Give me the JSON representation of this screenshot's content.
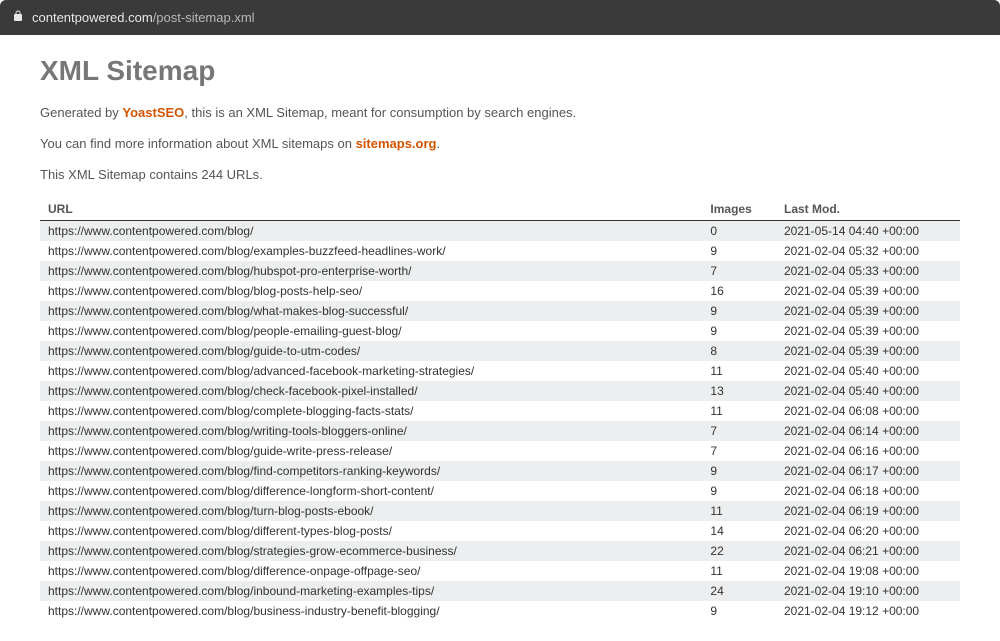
{
  "browser": {
    "domain": "contentpowered.com",
    "path": "/post-sitemap.xml"
  },
  "page": {
    "title": "XML Sitemap",
    "generated_prefix": "Generated by ",
    "generated_linktext": "YoastSEO",
    "generated_suffix": ", this is an XML Sitemap, meant for consumption by search engines.",
    "more_info_prefix": "You can find more information about XML sitemaps on ",
    "more_info_linktext": "sitemaps.org",
    "more_info_suffix": ".",
    "count_text": "This XML Sitemap contains 244 URLs."
  },
  "table": {
    "headers": {
      "url": "URL",
      "images": "Images",
      "lastmod": "Last Mod."
    },
    "rows": [
      {
        "url": "https://www.contentpowered.com/blog/",
        "images": "0",
        "lastmod": "2021-05-14 04:40 +00:00"
      },
      {
        "url": "https://www.contentpowered.com/blog/examples-buzzfeed-headlines-work/",
        "images": "9",
        "lastmod": "2021-02-04 05:32 +00:00"
      },
      {
        "url": "https://www.contentpowered.com/blog/hubspot-pro-enterprise-worth/",
        "images": "7",
        "lastmod": "2021-02-04 05:33 +00:00"
      },
      {
        "url": "https://www.contentpowered.com/blog/blog-posts-help-seo/",
        "images": "16",
        "lastmod": "2021-02-04 05:39 +00:00"
      },
      {
        "url": "https://www.contentpowered.com/blog/what-makes-blog-successful/",
        "images": "9",
        "lastmod": "2021-02-04 05:39 +00:00"
      },
      {
        "url": "https://www.contentpowered.com/blog/people-emailing-guest-blog/",
        "images": "9",
        "lastmod": "2021-02-04 05:39 +00:00"
      },
      {
        "url": "https://www.contentpowered.com/blog/guide-to-utm-codes/",
        "images": "8",
        "lastmod": "2021-02-04 05:39 +00:00"
      },
      {
        "url": "https://www.contentpowered.com/blog/advanced-facebook-marketing-strategies/",
        "images": "11",
        "lastmod": "2021-02-04 05:40 +00:00"
      },
      {
        "url": "https://www.contentpowered.com/blog/check-facebook-pixel-installed/",
        "images": "13",
        "lastmod": "2021-02-04 05:40 +00:00"
      },
      {
        "url": "https://www.contentpowered.com/blog/complete-blogging-facts-stats/",
        "images": "11",
        "lastmod": "2021-02-04 06:08 +00:00"
      },
      {
        "url": "https://www.contentpowered.com/blog/writing-tools-bloggers-online/",
        "images": "7",
        "lastmod": "2021-02-04 06:14 +00:00"
      },
      {
        "url": "https://www.contentpowered.com/blog/guide-write-press-release/",
        "images": "7",
        "lastmod": "2021-02-04 06:16 +00:00"
      },
      {
        "url": "https://www.contentpowered.com/blog/find-competitors-ranking-keywords/",
        "images": "9",
        "lastmod": "2021-02-04 06:17 +00:00"
      },
      {
        "url": "https://www.contentpowered.com/blog/difference-longform-short-content/",
        "images": "9",
        "lastmod": "2021-02-04 06:18 +00:00"
      },
      {
        "url": "https://www.contentpowered.com/blog/turn-blog-posts-ebook/",
        "images": "11",
        "lastmod": "2021-02-04 06:19 +00:00"
      },
      {
        "url": "https://www.contentpowered.com/blog/different-types-blog-posts/",
        "images": "14",
        "lastmod": "2021-02-04 06:20 +00:00"
      },
      {
        "url": "https://www.contentpowered.com/blog/strategies-grow-ecommerce-business/",
        "images": "22",
        "lastmod": "2021-02-04 06:21 +00:00"
      },
      {
        "url": "https://www.contentpowered.com/blog/difference-onpage-offpage-seo/",
        "images": "11",
        "lastmod": "2021-02-04 19:08 +00:00"
      },
      {
        "url": "https://www.contentpowered.com/blog/inbound-marketing-examples-tips/",
        "images": "24",
        "lastmod": "2021-02-04 19:10 +00:00"
      },
      {
        "url": "https://www.contentpowered.com/blog/business-industry-benefit-blogging/",
        "images": "9",
        "lastmod": "2021-02-04 19:12 +00:00"
      }
    ]
  }
}
